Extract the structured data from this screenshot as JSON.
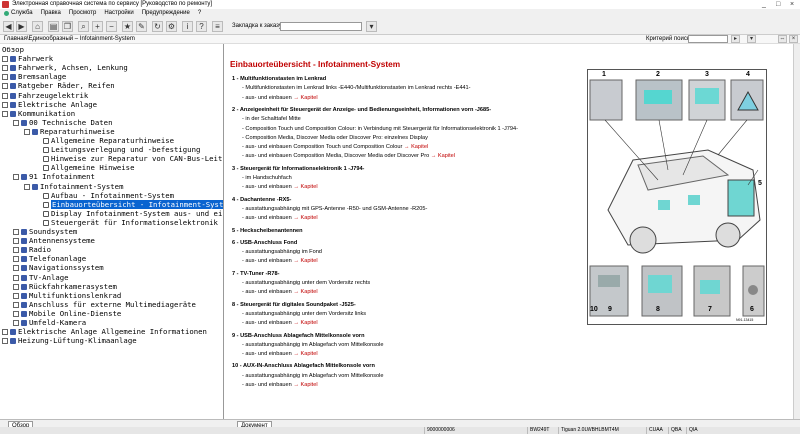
{
  "window": {
    "title": "Электронная справочная система по сервису  [Руководство по ремонту]",
    "controls": [
      "_",
      "□",
      "×"
    ]
  },
  "menu": [
    "Служба",
    "Правка",
    "Просмотр",
    "Настройки",
    "Предупреждение",
    "?"
  ],
  "toolbar": {
    "bookmark_label": "Закладка к заказу:"
  },
  "path": {
    "text": "Главная\\Единообразный – Infotainment-System",
    "criteria_label": "Критерий  поиска:"
  },
  "tree": [
    {
      "t": "Обзор",
      "lvl": 0,
      "ico": "none"
    },
    {
      "t": "Fahrwerk",
      "lvl": 0,
      "ico": "book"
    },
    {
      "t": "Fahrwerk, Achsen, Lenkung",
      "lvl": 0,
      "ico": "book"
    },
    {
      "t": "Bremsanlage",
      "lvl": 0,
      "ico": "book"
    },
    {
      "t": "Ratgeber Räder, Reifen",
      "lvl": 0,
      "ico": "book"
    },
    {
      "t": "Fahrzeugelektrik",
      "lvl": 0,
      "ico": "book"
    },
    {
      "t": "Elektrische Anlage",
      "lvl": 0,
      "ico": "book"
    },
    {
      "t": "Kommunikation",
      "lvl": 0,
      "ico": "book"
    },
    {
      "t": "00 Technische Daten",
      "lvl": 1,
      "ico": "book"
    },
    {
      "t": "Reparaturhinweise",
      "lvl": 2,
      "ico": "book"
    },
    {
      "t": "Allgemeine Reparaturhinweise",
      "lvl": 3,
      "ico": "page"
    },
    {
      "t": "Leitungsverlegung und -befestigung",
      "lvl": 3,
      "ico": "page"
    },
    {
      "t": "Hinweise zur Reparatur von CAN-Bus-Leitungen",
      "lvl": 3,
      "ico": "page"
    },
    {
      "t": "Allgemeine Hinweise",
      "lvl": 3,
      "ico": "page"
    },
    {
      "t": "91 Infotainment",
      "lvl": 1,
      "ico": "book"
    },
    {
      "t": "Infotainment-System",
      "lvl": 2,
      "ico": "book"
    },
    {
      "t": "Aufbau - Infotainment-System",
      "lvl": 3,
      "ico": "page"
    },
    {
      "t": "Einbauorteübersicht - Infotainment-System",
      "lvl": 3,
      "ico": "page",
      "sel": true
    },
    {
      "t": "Display Infotainment-System aus- und einbauen",
      "lvl": 3,
      "ico": "page"
    },
    {
      "t": "Steuergerät für Informationselektronik 1 J79",
      "lvl": 3,
      "ico": "page"
    },
    {
      "t": "Soundsystem",
      "lvl": 1,
      "ico": "book"
    },
    {
      "t": "Antennensysteme",
      "lvl": 1,
      "ico": "book"
    },
    {
      "t": "Radio",
      "lvl": 1,
      "ico": "book"
    },
    {
      "t": "Telefonanlage",
      "lvl": 1,
      "ico": "book"
    },
    {
      "t": "Navigationssystem",
      "lvl": 1,
      "ico": "book"
    },
    {
      "t": "TV-Anlage",
      "lvl": 1,
      "ico": "book"
    },
    {
      "t": "Rückfahrkamerasystem",
      "lvl": 1,
      "ico": "book"
    },
    {
      "t": "Multifunktionslenkrad",
      "lvl": 1,
      "ico": "book"
    },
    {
      "t": "Anschluss für externe Multimediageräte",
      "lvl": 1,
      "ico": "book"
    },
    {
      "t": "Mobile Online-Dienste",
      "lvl": 1,
      "ico": "book"
    },
    {
      "t": "Umfeld-Kamera",
      "lvl": 1,
      "ico": "book"
    },
    {
      "t": "Elektrische Anlage Allgemeine Informationen",
      "lvl": 0,
      "ico": "book"
    },
    {
      "t": "Heizung-Lüftung-Klimaanlage",
      "lvl": 0,
      "ico": "book"
    }
  ],
  "content": {
    "heading": "Einbauorteübersicht - Infotainment-System",
    "items": [
      {
        "t": "1 - Multifunktionstasten im Lenkrad",
        "s": "t"
      },
      {
        "t": "Multifunktionstasten im Lenkrad links -E440-/Multifunktionstasten im Lenkrad rechts -E441-",
        "s": "b"
      },
      {
        "t": "aus- und einbauen",
        "s": "b",
        "link": "→ Kapitel"
      },
      {
        "t": "2 - Anzeigeeinheit für Steuergerät der Anzeige- und Bedienungseinheit, Informationen vorn -J685-",
        "s": "t"
      },
      {
        "t": "in der Schalttafel Mitte",
        "s": "b"
      },
      {
        "t": "Composition Touch und Composition Colour: in Verbindung mit Steuergerät für Informationselektronik 1 -J794-",
        "s": "b"
      },
      {
        "t": "Composition Media, Discover Media oder Discover Pro: einzelnes Display",
        "s": "b"
      },
      {
        "t": "aus- und einbauen Composition Touch und Composition Colour",
        "s": "b",
        "link": "→ Kapitel"
      },
      {
        "t": "aus- und einbauen Composition Media, Discover Media oder Discover Pro",
        "s": "b",
        "link": "→ Kapitel"
      },
      {
        "t": "3 - Steuergerät für Informationselektronik 1 -J794-",
        "s": "t"
      },
      {
        "t": "im Handschuhfach",
        "s": "b"
      },
      {
        "t": "aus- und einbauen",
        "s": "b",
        "link": "→ Kapitel"
      },
      {
        "t": "4 - Dachantenne -RX5-",
        "s": "t"
      },
      {
        "t": "ausstattungsabhängig mit GPS-Antenne -R50- und GSM-Antenne -R205-",
        "s": "b"
      },
      {
        "t": "aus- und einbauen",
        "s": "b",
        "link": "→ Kapitel"
      },
      {
        "t": "5 - Heckscheibenantennen",
        "s": "t"
      },
      {
        "t": "6 - USB-Anschluss Fond",
        "s": "t"
      },
      {
        "t": "ausstattungsabhängig im Fond",
        "s": "b"
      },
      {
        "t": "aus- und einbauen",
        "s": "b",
        "link": "→ Kapitel"
      },
      {
        "t": "7 - TV-Tuner -R78-",
        "s": "t"
      },
      {
        "t": "ausstattungsabhängig unter dem Vordersitz rechts",
        "s": "b"
      },
      {
        "t": "aus- und einbauen",
        "s": "b",
        "link": "→ Kapitel"
      },
      {
        "t": "8 - Steuergerät für digitales Soundpaket -J525-",
        "s": "t"
      },
      {
        "t": "ausstattungsabhängig unter dem Vordersitz links",
        "s": "b"
      },
      {
        "t": "aus- und einbauen",
        "s": "b",
        "link": "→ Kapitel"
      },
      {
        "t": "9 - USB-Anschluss Ablagefach Mittelkonsole vorn",
        "s": "t"
      },
      {
        "t": "ausstattungsabhängig im Ablagefach vorn Mittelkonsole",
        "s": "b"
      },
      {
        "t": "aus- und einbauen",
        "s": "b",
        "link": "→ Kapitel"
      },
      {
        "t": "10 - AUX-IN-Anschluss Ablagefach Mittelkonsole vorn",
        "s": "t"
      },
      {
        "t": "ausstattungsabhängig im Ablagefach vorn Mittelkonsole",
        "s": "b"
      },
      {
        "t": "aus- und einbauen",
        "s": "b",
        "link": "→ Kapitel"
      }
    ],
    "figure": {
      "labels": [
        "1",
        "2",
        "3",
        "4",
        "5",
        "10",
        "9",
        "8",
        "7",
        "6"
      ],
      "code": "N91-13415"
    }
  },
  "tabs": {
    "left": "Обзор",
    "right": "Документ"
  },
  "status": [
    "9000000006",
    "BW249T",
    "Tiguan 2.0LWBHLBMT4M",
    "CUAA",
    "QBA",
    "QIA"
  ]
}
